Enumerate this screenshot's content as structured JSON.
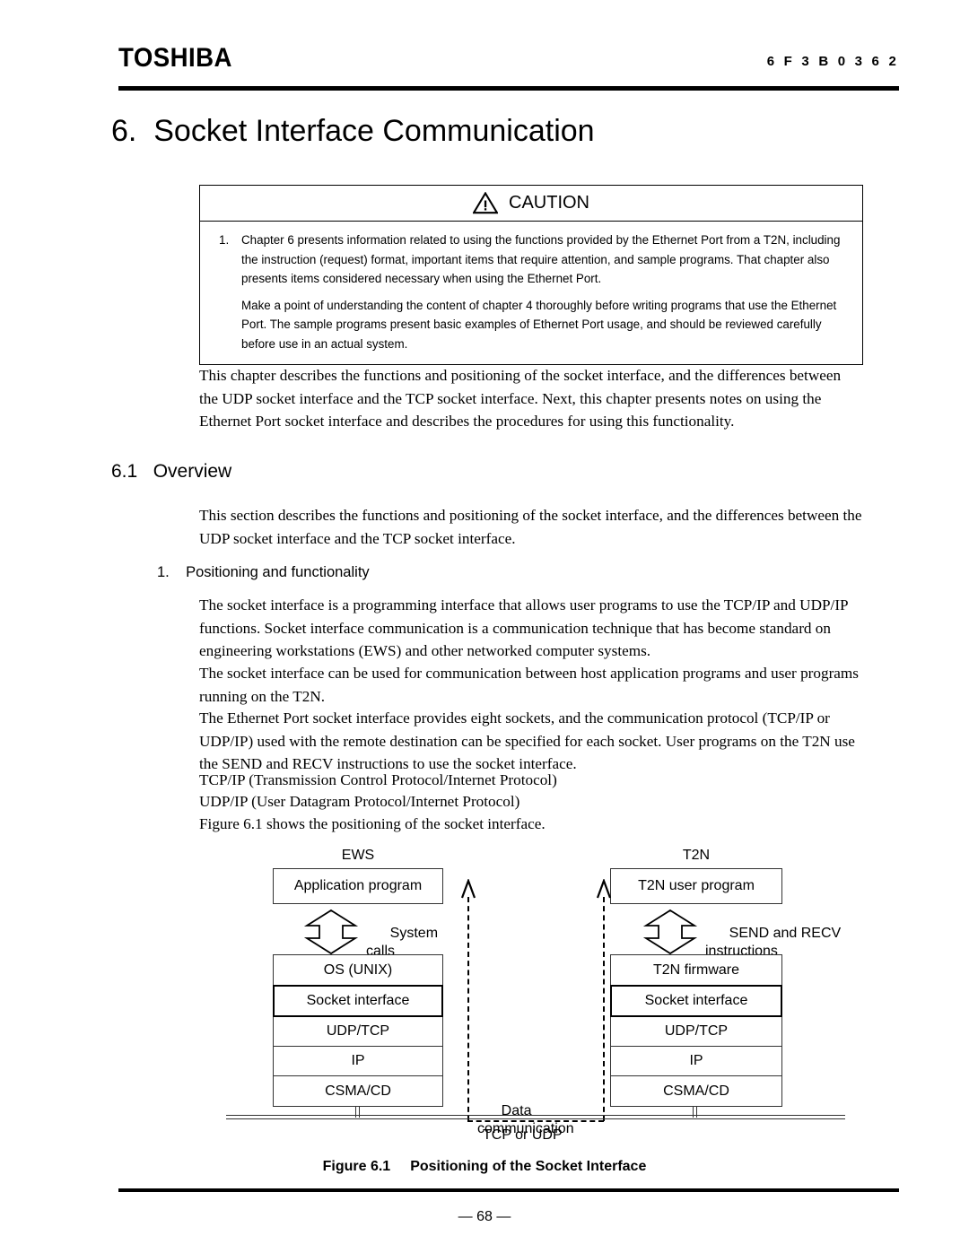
{
  "header": {
    "brand": "TOSHIBA",
    "doc_number": "6 F 3 B 0 3 6 2"
  },
  "chapter": {
    "title": "6.  Socket Interface Communication"
  },
  "caution": {
    "title": "CAUTION",
    "icon": "warning-triangle-icon",
    "item_number": "1.",
    "paragraphs": [
      "Chapter 6 presents information related to using the functions provided by the Ethernet Port from a T2N, including the instruction (request) format, important items that require attention, and sample programs. That chapter also presents items considered necessary when using the Ethernet Port.",
      "Make a point of understanding the content of chapter 4 thoroughly before writing programs that use the Ethernet Port. The sample programs present basic examples of Ethernet Port usage, and should be reviewed carefully before use in an actual system."
    ]
  },
  "body": {
    "intro": "This chapter describes the functions and positioning of the socket interface, and the differences between the UDP socket interface and the TCP socket interface. Next, this chapter presents notes on using the Ethernet Port socket interface and describes the procedures for using this functionality.",
    "section_heading": "6.1   Overview",
    "section_intro": "This section describes the functions and positioning of the socket interface, and the differences between the UDP socket interface and the TCP socket interface.",
    "sub_heading": "1.    Positioning and functionality",
    "p1": "The socket interface is a programming interface that allows user programs to use the TCP/IP and UDP/IP functions. Socket interface communication is a communication technique that has become standard on engineering workstations (EWS) and other networked computer systems.",
    "p2": "The socket interface can be used for communication between host application programs and user programs running on the T2N.",
    "p3": "The Ethernet Port socket interface provides eight sockets, and the communication protocol (TCP/IP or UDP/IP) used with the remote destination can be specified for each socket. User programs on the T2N use the SEND and RECV instructions to use the socket interface.",
    "abbr1": "TCP/IP (Transmission Control Protocol/Internet Protocol)",
    "abbr2": "UDP/IP (User Datagram Protocol/Internet Protocol)",
    "figure_reference": "Figure 6.1 shows the positioning of the socket interface."
  },
  "figure": {
    "caption_label": "Figure 6.1",
    "caption_title": "Positioning of the Socket Interface",
    "left_stack": {
      "title": "EWS",
      "top_box": "Application program",
      "arrow_label": "System\ncalls",
      "layers": [
        "OS (UNIX)",
        "Socket interface",
        "UDP/TCP",
        "IP",
        "CSMA/CD"
      ]
    },
    "right_stack": {
      "title": "T2N",
      "top_box": "T2N user program",
      "arrow_label": "SEND and RECV\ninstructions",
      "layers": [
        "T2N firmware",
        "Socket interface",
        "UDP/TCP",
        "IP",
        "CSMA/CD"
      ]
    },
    "data_path": {
      "label": "Data\ncommunication",
      "protocol_label": "TCP or UDP"
    }
  },
  "footer": {
    "page_number": "— 68 —"
  }
}
